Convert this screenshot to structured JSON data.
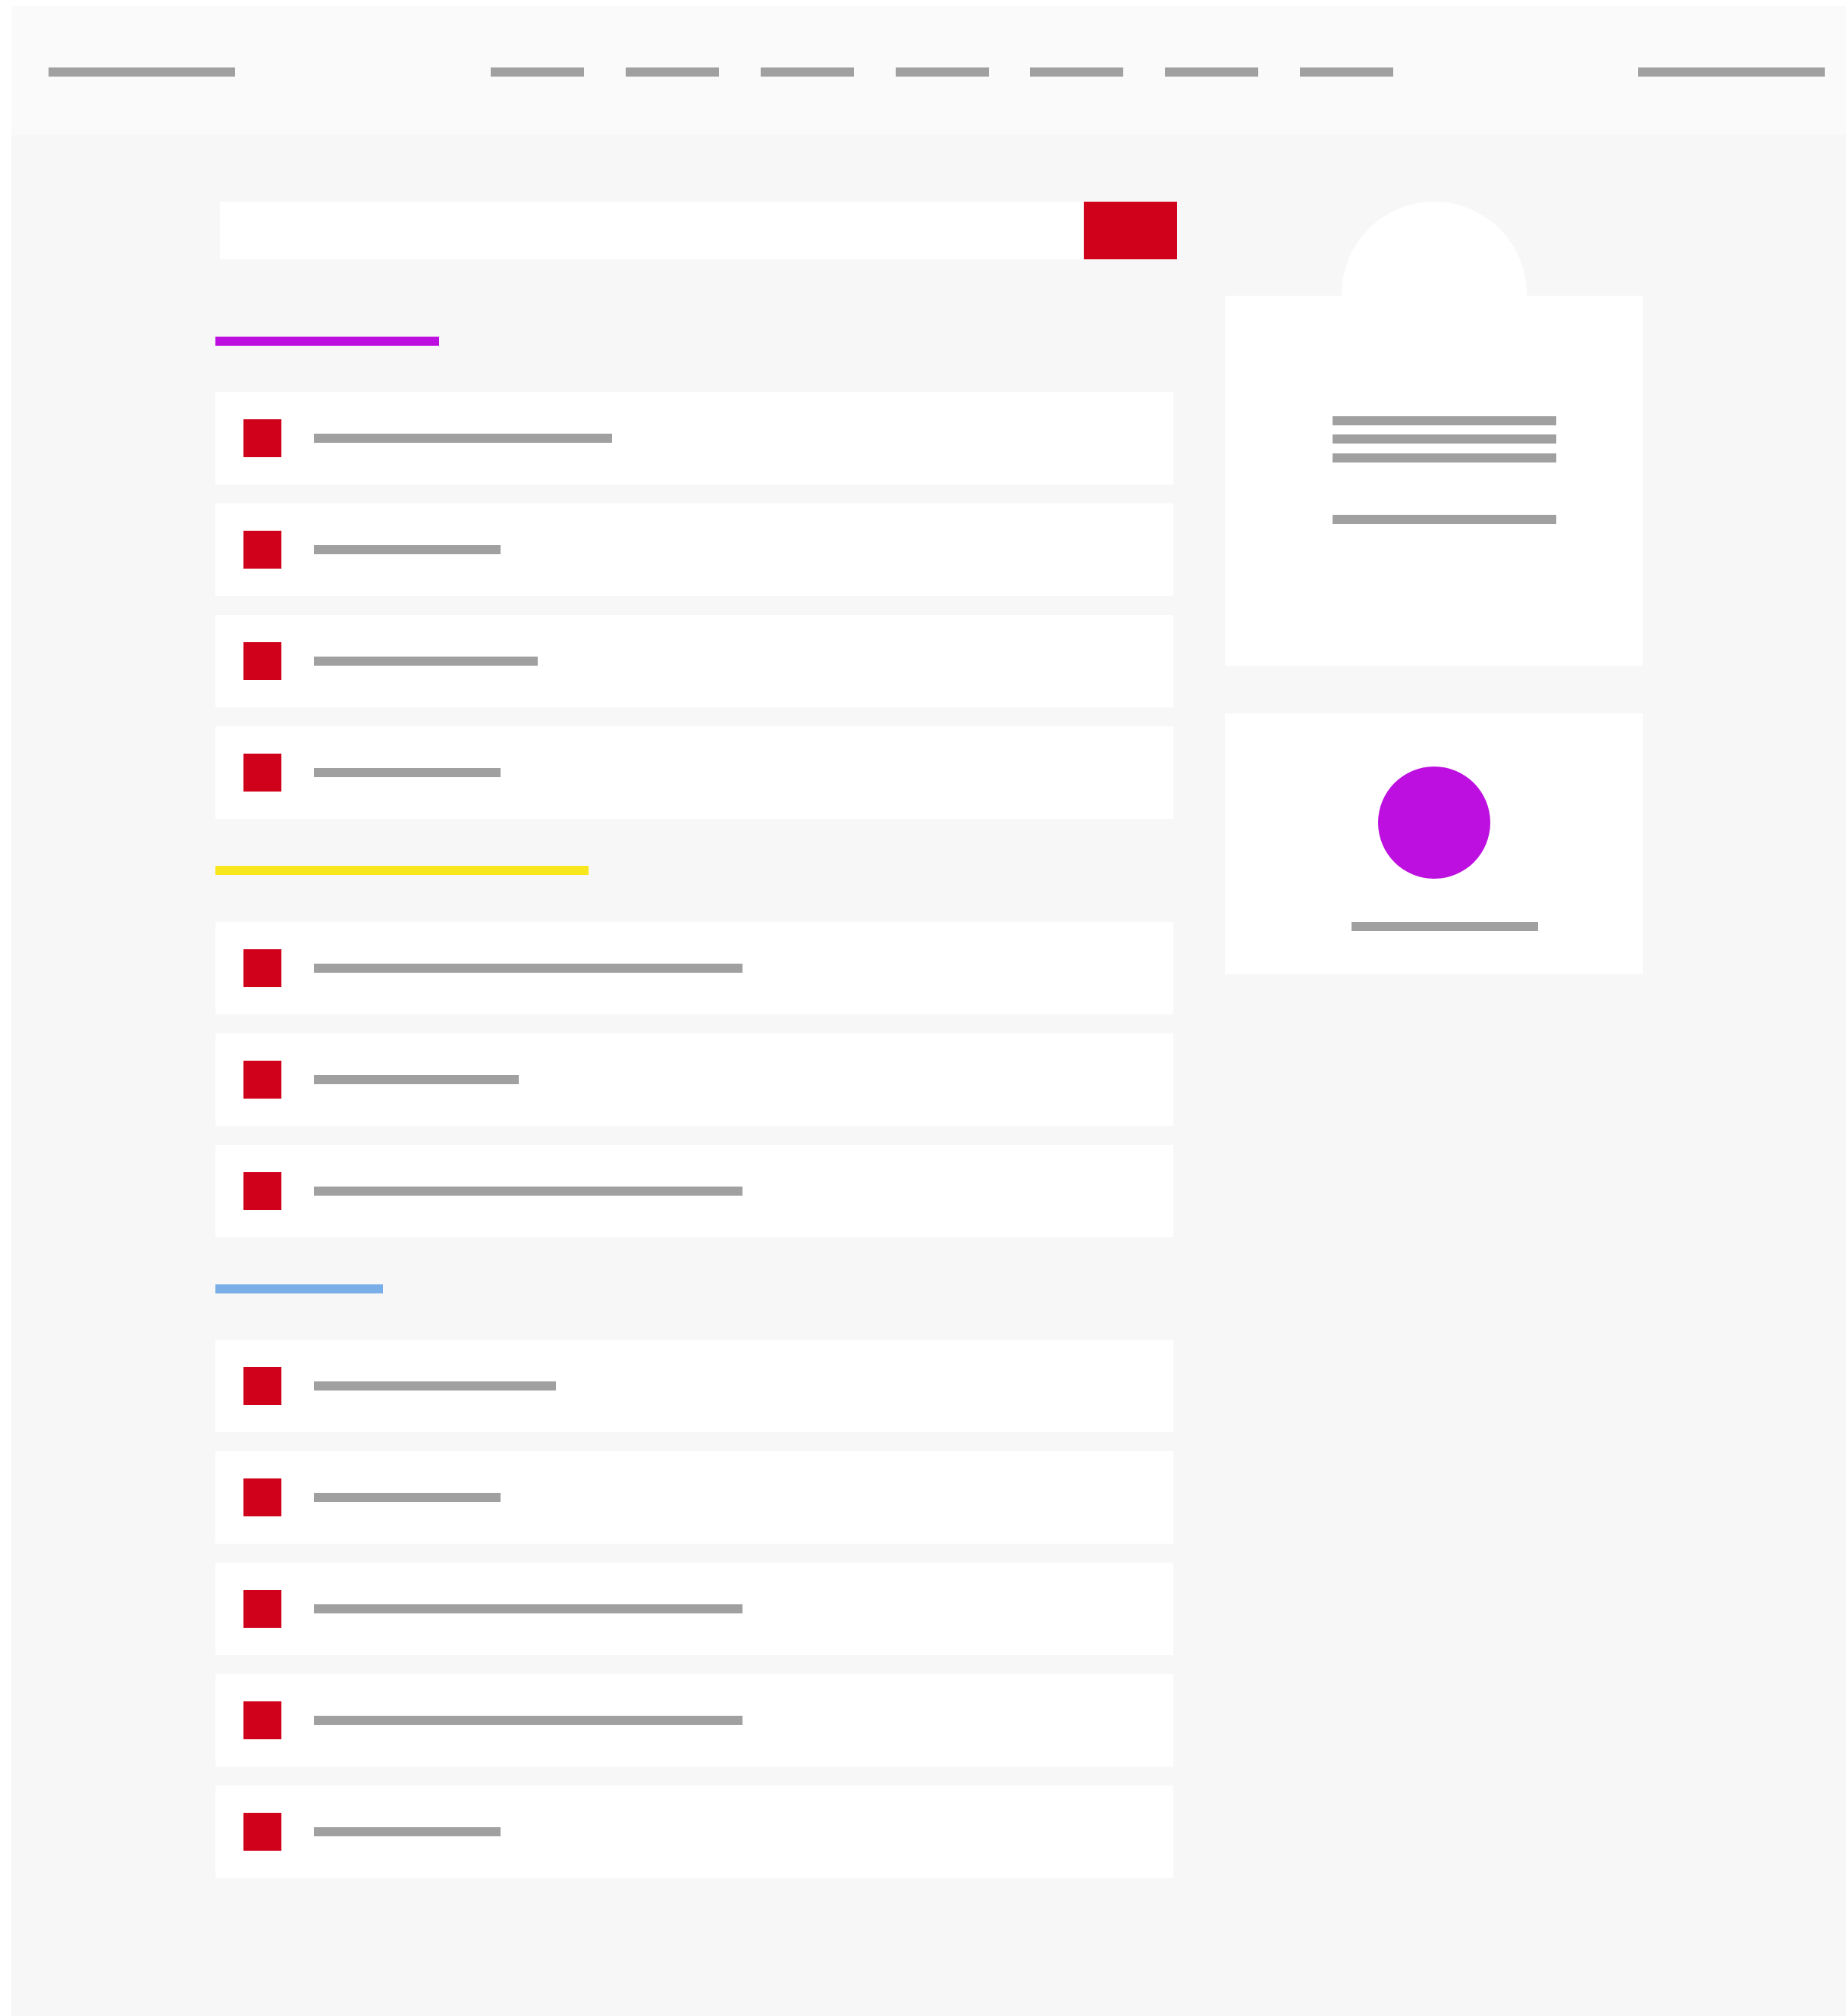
{
  "colors": {
    "page_background": "#f7f7f7",
    "header_background": "#fafafa",
    "placeholder_text_bar": "#a0a0a0",
    "accent_red": "#d0021b",
    "card_background": "#ffffff",
    "section_1_accent": "#bd10e0",
    "section_2_accent": "#f8e71c",
    "section_3_accent": "#7aaee8",
    "widget_avatar": "#bd10e0"
  },
  "header": {
    "logo": "",
    "nav_items": [
      "",
      "",
      "",
      "",
      "",
      "",
      ""
    ],
    "account_link": ""
  },
  "search": {
    "placeholder": "",
    "value": "",
    "button_label": ""
  },
  "sections": [
    {
      "title": "",
      "items": [
        {
          "label": "",
          "icon": "red-square-icon"
        },
        {
          "label": "",
          "icon": "red-square-icon"
        },
        {
          "label": "",
          "icon": "red-square-icon"
        },
        {
          "label": "",
          "icon": "red-square-icon"
        }
      ]
    },
    {
      "title": "",
      "items": [
        {
          "label": "",
          "icon": "red-square-icon"
        },
        {
          "label": "",
          "icon": "red-square-icon"
        },
        {
          "label": "",
          "icon": "red-square-icon"
        }
      ]
    },
    {
      "title": "",
      "items": [
        {
          "label": "",
          "icon": "red-square-icon"
        },
        {
          "label": "",
          "icon": "red-square-icon"
        },
        {
          "label": "",
          "icon": "red-square-icon"
        },
        {
          "label": "",
          "icon": "red-square-icon"
        },
        {
          "label": "",
          "icon": "red-square-icon"
        }
      ]
    }
  ],
  "sidebar": {
    "profile": {
      "text_lines": [
        "",
        "",
        ""
      ],
      "footer_line": ""
    },
    "user_widget": {
      "name": ""
    }
  }
}
